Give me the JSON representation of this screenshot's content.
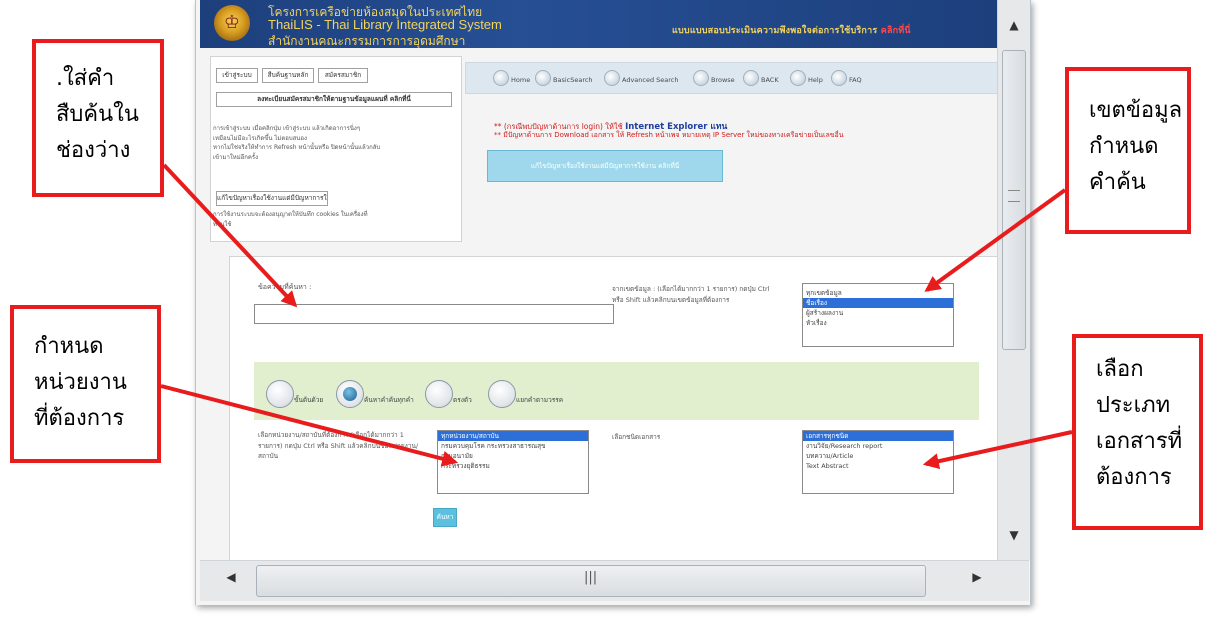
{
  "header": {
    "line1": "โครงการเครือข่ายห้องสมุดในประเทศไทย",
    "line2": "ThaiLIS - Thai Library Integrated System",
    "line3": "สำนักงานคณะกรรมการการอุดมศึกษา",
    "survey_text": "แบบแบบสอบประเมินความพึงพอใจต่อการใช้บริการ",
    "survey_tail": "คลิกที่นี่"
  },
  "left_panel": {
    "login_button": "เข้าสู่ระบบ",
    "search_button": "สืบค้นฐานหลัก",
    "signup_button": "สมัครสมาชิก",
    "register_button": "ลงทะเบียนสมัครสมาชิกให้ตามฐานข้อมูลแผนที่ คลิกที่นี่",
    "note_lines": [
      "การเข้าสู่ระบบ เมื่อคลิกปุ่ม เข้าสู่ระบบ แล้วเกิดอาการนิ่งๆ",
      "เหมือนไม่มีอะไรเกิดขึ้น ไม่ตอบสนอง",
      "หากไม่ใช่จริงให้ทำการ Refresh หน้านั้นหรือ ปิดหน้านั้นแล้วกลับ",
      "เข้ามาใหม่อีกครั้ง"
    ],
    "fix_button": "แก้ไขปัญหาเรื่องใช้งานแต่มีปัญหาการใช้งาน คลิกที่นี่",
    "note2_lines": [
      "การใช้งานระบบจะต้องอนุญาตให้บันทึก cookies ในเครื่องที่",
      "ท่านใช้"
    ]
  },
  "nav": {
    "items": [
      "Home",
      "BasicSearch",
      "Advanced Search",
      "Browse",
      "BACK",
      "Help",
      "FAQ"
    ]
  },
  "notice": {
    "line1_prefix": "** (กรณีพบปัญหาด้านการ login) ให้ใช้",
    "line1_highlight": "Internet Explorer แทน",
    "line2": "** มีปัญหาด้านการ Download เอกสาร ให้ Refresh หน้าเพจ หมายเหตุ IP Server ใหม่ของทางเครือข่ายเป็นเลขอื่น",
    "info_button": "แก้ไขปัญหาเรื่องใช้งานแต่มีปัญหาการใช้งาน คลิกที่นี่"
  },
  "search_form": {
    "keyword_label": "ข้อความที่ค้นหา :",
    "keyword_value": "",
    "field_label": "จากเขตข้อมูล : (เลือกได้มากกว่า 1 รายการ) กดปุ่ม Ctrl หรือ Shift แล้วคลิกบนเขตข้อมูลที่ต้องการ",
    "field_options": [
      "ทุกเขตข้อมูล",
      "ชื่อเรื่อง",
      "ผู้สร้างผลงาน",
      "หัวเรื่อง"
    ],
    "field_selected_index": 1,
    "radio_options": [
      "ขั้นต้นด้วย",
      "ค้นหาคำค้นทุกคำ",
      "ตรงตัว",
      "แยกคำตามวรรค"
    ],
    "radio_selected_index": 1,
    "unit_label": "เลือกหน่วยงาน/สถาบันที่ต้องการ (เลือกได้มากกว่า 1 รายการ) กดปุ่ม Ctrl หรือ Shift แล้วคลิกบนชื่อหน่วยงาน/สถาบัน",
    "unit_options": [
      "ทุกหน่วยงาน/สถาบัน",
      "กรมควบคุมโรค กระทรวงสาธารณสุข",
      "กรมอนามัย",
      "กระทรวงยุติธรรม"
    ],
    "doctype_label": "เลือกชนิดเอกสาร",
    "doctype_options": [
      "เอกสารทุกชนิด",
      "งานวิจัย/Research report",
      "บทความ/Article",
      "Text Abstract"
    ],
    "search_button": "ค้นหา"
  },
  "callouts": {
    "c1": [
      ".ใส่คำ",
      "สืบค้นใน",
      "ช่องว่าง"
    ],
    "c2": [
      "เขตข้อมูล",
      "กำหนด",
      "คำค้น"
    ],
    "c3": [
      "กำหนด",
      "หน่วยงาน",
      "ที่ต้องการ"
    ],
    "c4": [
      "เลือก",
      "ประเภท",
      "เอกสารที่",
      "ต้องการ"
    ]
  },
  "colors": {
    "callout_red": "#e81c1c",
    "header_blue": "#1d3f7c",
    "header_text": "#f3d35c",
    "selection_blue": "#2c6fd8",
    "option_band": "#e1efcf"
  },
  "icons": {
    "logo": "thailis-seal-icon",
    "scroll_up": "chevron-up-icon",
    "scroll_down": "chevron-down-icon",
    "scroll_left": "chevron-left-icon",
    "scroll_right": "chevron-right-icon"
  }
}
